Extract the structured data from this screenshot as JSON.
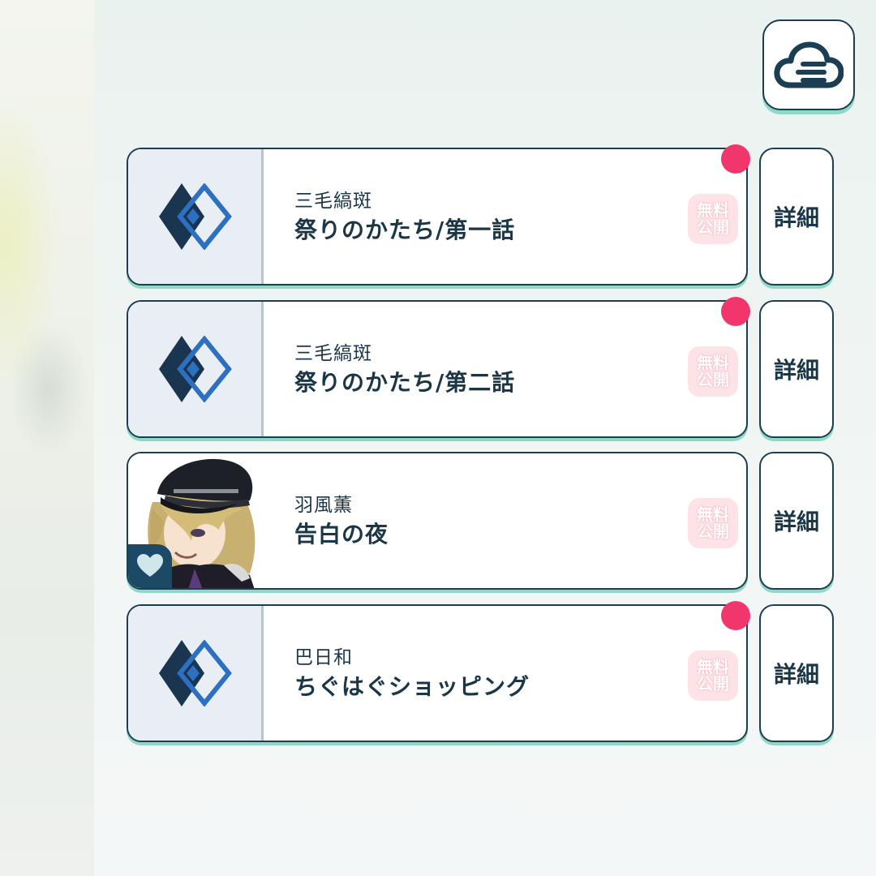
{
  "stories": [
    {
      "unit": "三毛縞斑",
      "title": "祭りのかたち/第一話",
      "badge_line1": "無料",
      "badge_line2": "公開",
      "thumbnail": "diamond-logo-icon",
      "new": true,
      "detail_label": "詳細"
    },
    {
      "unit": "三毛縞斑",
      "title": "祭りのかたち/第二話",
      "badge_line1": "無料",
      "badge_line2": "公開",
      "thumbnail": "diamond-logo-icon",
      "new": true,
      "detail_label": "詳細"
    },
    {
      "unit": "羽風薫",
      "title": "告白の夜",
      "badge_line1": "無料",
      "badge_line2": "公開",
      "thumbnail": "character-portrait",
      "new": false,
      "favorite_icon": "heart-icon",
      "detail_label": "詳細"
    },
    {
      "unit": "巴日和",
      "title": "ちぐはぐショッピング",
      "badge_line1": "無料",
      "badge_line2": "公開",
      "thumbnail": "diamond-logo-icon",
      "new": true,
      "detail_label": "詳細"
    }
  ],
  "toolbar": {
    "cloud_menu_icon": "cloud-menu-icon"
  },
  "colors": {
    "outline": "#1c3e52",
    "accent_shadow": "#8fd8c6",
    "new_dot": "#f0366a",
    "badge_bg": "#fde3e6",
    "logo_dark": "#1a3550",
    "logo_blue": "#2d6fc0"
  }
}
